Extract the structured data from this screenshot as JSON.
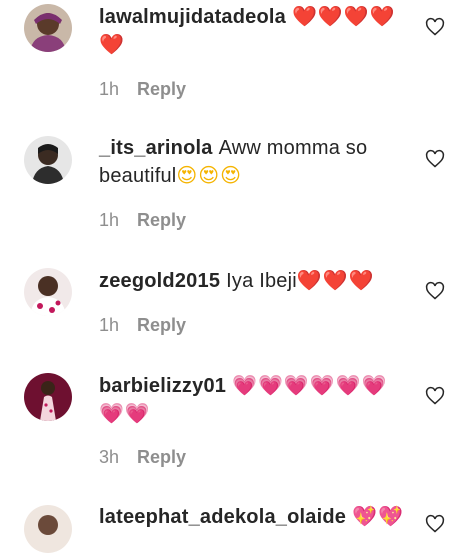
{
  "colors": {
    "text": "#262626",
    "muted": "#8e8e8e",
    "heart_red": "#e0112b",
    "heart_pink": "#f06292"
  },
  "comments": [
    {
      "username": "lawalmujidatadeola",
      "text": "",
      "emoji": "❤️❤️❤️❤️❤️",
      "time": "1h",
      "reply": "Reply"
    },
    {
      "username": "_its_arinola",
      "text": "Aww momma so beautiful",
      "emoji": "😍😍😍",
      "time": "1h",
      "reply": "Reply"
    },
    {
      "username": "zeegold2015",
      "text": "Iya Ibeji",
      "emoji": "❤️❤️❤️",
      "time": "1h",
      "reply": "Reply"
    },
    {
      "username": "barbielizzy01",
      "text": "",
      "emoji": "💗💗💗💗💗💗💗💗",
      "time": "3h",
      "reply": "Reply"
    },
    {
      "username": "lateephat_adekola_olaide",
      "text": "",
      "emoji": "💖💖",
      "time": "",
      "reply": ""
    }
  ]
}
